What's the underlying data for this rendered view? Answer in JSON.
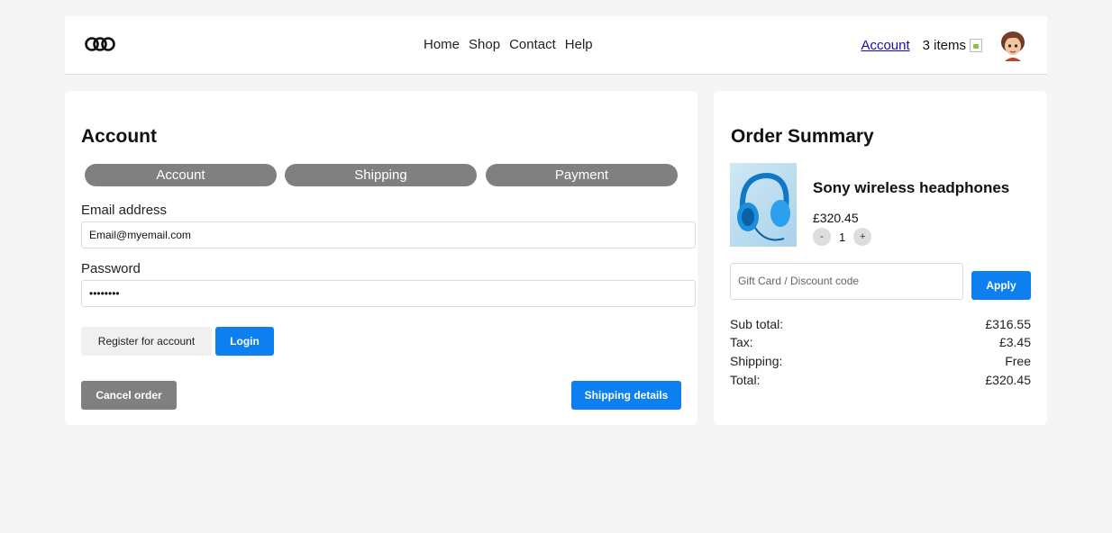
{
  "header": {
    "nav": [
      "Home",
      "Shop",
      "Contact",
      "Help"
    ],
    "account_link": "Account",
    "cart_count": "3 items"
  },
  "account": {
    "title": "Account",
    "steps": [
      "Account",
      "Shipping",
      "Payment"
    ],
    "email_label": "Email address",
    "email_value": "Email@myemail.com",
    "password_label": "Password",
    "password_value": "••••••••",
    "register_label": "Register for account",
    "login_label": "Login",
    "cancel_label": "Cancel order",
    "shipping_details_label": "Shipping details"
  },
  "summary": {
    "title": "Order Summary",
    "product_name": "Sony wireless headphones",
    "product_price": "£320.45",
    "qty_minus": "-",
    "quantity": "1",
    "qty_plus": "+",
    "discount_placeholder": "Gift Card / Discount code",
    "apply_label": "Apply",
    "rows": [
      {
        "label": "Sub total:",
        "value": "£316.55"
      },
      {
        "label": "Tax:",
        "value": "£3.45"
      },
      {
        "label": "Shipping:",
        "value": "Free"
      },
      {
        "label": "Total:",
        "value": "£320.45"
      }
    ]
  },
  "colors": {
    "primary": "#0d7ff0",
    "step_bg": "#808080",
    "page_bg": "#f5f5f5"
  }
}
